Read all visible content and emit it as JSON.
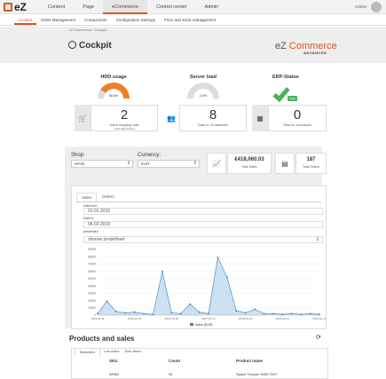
{
  "topbar": {
    "logo": "eZ",
    "nav": [
      "Content",
      "Page",
      "eCommerce",
      "Control center",
      "Admin"
    ],
    "active_index": 2,
    "user": "Admin"
  },
  "subnav": {
    "items": [
      "Cockpit",
      "Order Management",
      "Components",
      "Configuration Settings",
      "Price and stock management"
    ],
    "active_index": 0
  },
  "breadcrumb": "eZ Commerce  /  Cockpit",
  "header": {
    "title": "Cockpit",
    "brand_prefix": "eZ ",
    "brand_main": "Commerce",
    "brand_sub": "ADVANCED"
  },
  "gauges": [
    {
      "title": "HDD usage",
      "value": "68.6%",
      "min": "0",
      "max": "100",
      "fraction": 0.686
    },
    {
      "title": "Server load",
      "value": "2.0%",
      "min": "0",
      "max": "100",
      "fraction": 0.02
    }
  ],
  "erp": {
    "title": "ERP-Status",
    "badge": "Okay"
  },
  "kpis": [
    {
      "icon": "cart-icon",
      "value": "2",
      "label": "Active shopping carts",
      "sublabel": "in the last 3 hours"
    },
    {
      "icon": "users-icon",
      "value": "8",
      "label": "Total no. of customers"
    },
    {
      "icon": "cubes-icon",
      "value": "0",
      "label": "Total no. of products"
    }
  ],
  "filters": {
    "shop_label": "Shop:",
    "shop_value": "MAIN",
    "currency_label": "Currency:",
    "currency_value": "EUR"
  },
  "stats": {
    "sales_value": "€418,060.03",
    "sales_label": "Total Sales",
    "orders_value": "187",
    "orders_label": "Total Orders"
  },
  "sales_tabs": [
    "Sales",
    "Orders"
  ],
  "date_form": {
    "from_label": "Date from",
    "from_value": "01.01.2015",
    "to_label": "Date to",
    "to_value": "04.02.2019",
    "predefined_label": "predefined",
    "predefined_value": "choose predefined"
  },
  "chart_data": {
    "type": "area",
    "title": "",
    "legend": "Sales (EUR)",
    "legend_position": "bottom",
    "ylim": [
      0,
      90000
    ],
    "yticks": [
      "0",
      "10000",
      "20000",
      "30000",
      "40000",
      "50000",
      "60000",
      "70000",
      "80000",
      "90000"
    ],
    "x_tick_labels": [
      "2015-01-11",
      "2016-04-05",
      "2016-12-18",
      "2017-10-17",
      "2018-05-16",
      "2018-12-02",
      "2019-01-17"
    ],
    "x": [
      "2015-01",
      "2015-03",
      "2015-05",
      "2015-07",
      "2015-09",
      "2015-11",
      "2016-01",
      "2016-03",
      "2016-05",
      "2016-07",
      "2016-09",
      "2016-11",
      "2017-01",
      "2017-03",
      "2017-05",
      "2017-07",
      "2017-09",
      "2017-11",
      "2018-01",
      "2018-03",
      "2018-05",
      "2018-07",
      "2018-09",
      "2018-11",
      "2019-01"
    ],
    "series": [
      {
        "name": "Sales (EUR)",
        "values": [
          2000,
          19000,
          5000,
          3000,
          4000,
          2000,
          1000,
          60000,
          3000,
          2000,
          15000,
          4000,
          2000,
          79000,
          52000,
          6000,
          3000,
          8000,
          2000,
          2000,
          1000,
          2000,
          1000,
          2000,
          1000
        ]
      }
    ]
  },
  "products": {
    "title": "Products and sales",
    "tabs": [
      "Bestsellers",
      "Last orders",
      "Best clients"
    ],
    "columns": [
      "SKU",
      "Count",
      "Product name"
    ],
    "rows": [
      [
        "45960",
        "30",
        "Space Trooper 4000 CMY"
      ]
    ]
  },
  "colors": {
    "accent": "#e0531f",
    "success": "#49b35a",
    "chart": "#6fa8dc"
  }
}
